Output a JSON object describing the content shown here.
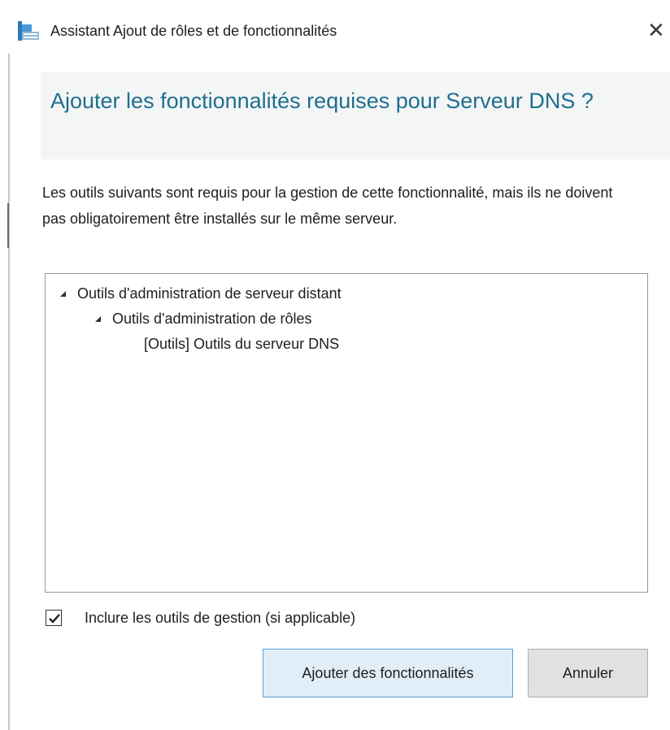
{
  "window": {
    "title": "Assistant Ajout de rôles et de fonctionnalités",
    "close_label": "✕"
  },
  "dialog": {
    "heading": "Ajouter les fonctionnalités requises pour Serveur DNS ?",
    "description": "Les outils suivants sont requis pour la gestion de cette fonctionnalité, mais ils ne doivent pas obligatoirement être installés sur le même serveur."
  },
  "tree": {
    "items": [
      {
        "label": "Outils d'administration de serveur distant",
        "level": 0,
        "expanded": true
      },
      {
        "label": "Outils d'administration de rôles",
        "level": 1,
        "expanded": true
      },
      {
        "label": "[Outils] Outils du serveur DNS",
        "level": 2,
        "expanded": false
      }
    ]
  },
  "options": {
    "include_tools_label": "Inclure les outils de gestion (si applicable)",
    "include_tools_checked": true
  },
  "buttons": {
    "add_features": "Ajouter des fonctionnalités",
    "cancel": "Annuler"
  },
  "icons": {
    "app": "server-manager-wizard-icon",
    "close": "close-icon",
    "tree_expand": "tree-expanded-arrow-icon",
    "check": "checkmark-icon"
  },
  "colors": {
    "heading": "#1f6e90",
    "primary_button_bg": "#e1eef8",
    "primary_button_border": "#5b9ed6",
    "secondary_button_bg": "#e1e1e1",
    "header_band": "#f4f6f6"
  }
}
